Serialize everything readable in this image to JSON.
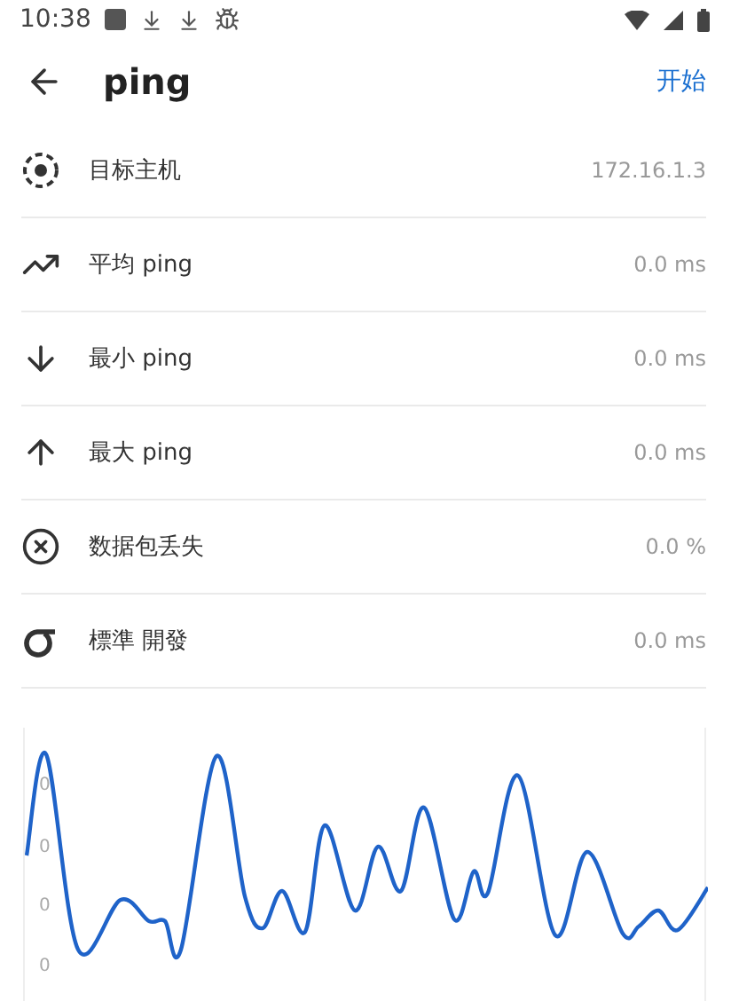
{
  "status_bar": {
    "time": "10:38"
  },
  "header": {
    "title": "ping",
    "action": "开始"
  },
  "rows": [
    {
      "kind": "target",
      "label": "目标主机",
      "value": "172.16.1.3"
    },
    {
      "kind": "average",
      "label": "平均 ping",
      "value": "0.0 ms"
    },
    {
      "kind": "min",
      "label": "最小 ping",
      "value": "0.0 ms"
    },
    {
      "kind": "max",
      "label": "最大 ping",
      "value": "0.0 ms"
    },
    {
      "kind": "loss",
      "label": "数据包丢失",
      "value": "0.0 %"
    },
    {
      "kind": "stddev",
      "label": "標準 開發",
      "value": "0.0 ms"
    }
  ],
  "chart": {
    "axis_labels": [
      "0",
      "0",
      "0",
      "0"
    ]
  }
}
